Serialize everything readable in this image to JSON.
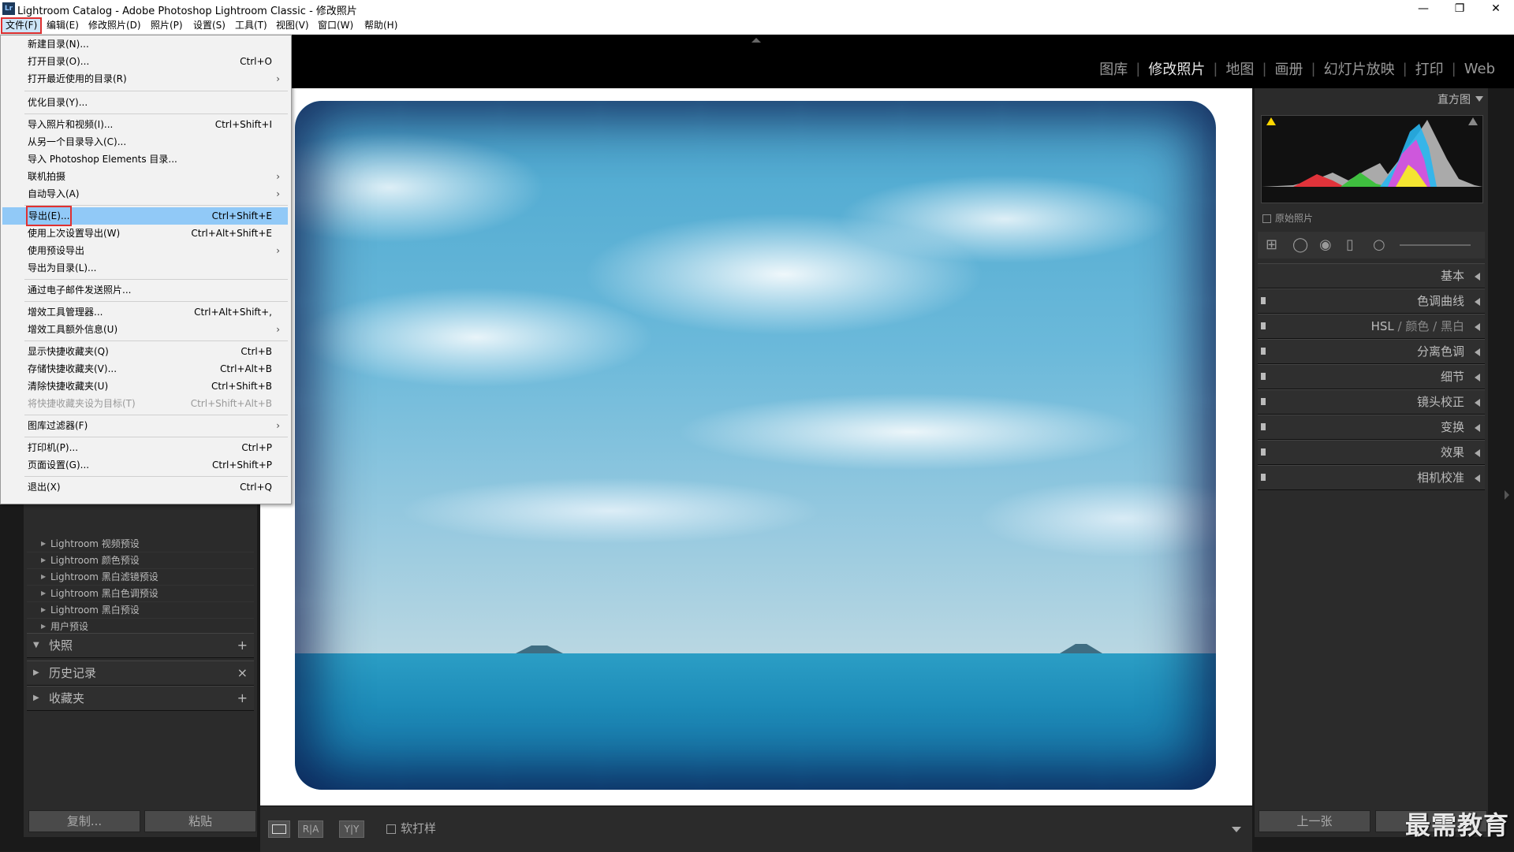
{
  "window": {
    "title": "Lightroom Catalog - Adobe Photoshop Lightroom Classic - 修改照片",
    "icon_text": "Lr",
    "controls": [
      "—",
      "❐",
      "✕"
    ]
  },
  "menubar": [
    "文件(F)",
    "编辑(E)",
    "修改照片(D)",
    "照片(P)",
    "设置(S)",
    "工具(T)",
    "视图(V)",
    "窗口(W)",
    "帮助(H)"
  ],
  "file_menu": {
    "items": [
      {
        "label": "新建目录(N)...",
        "shortcut": ""
      },
      {
        "label": "打开目录(O)...",
        "shortcut": "Ctrl+O"
      },
      {
        "label": "打开最近使用的目录(R)",
        "shortcut": "",
        "submenu": true
      },
      {
        "label": "优化目录(Y)...",
        "shortcut": ""
      },
      {
        "label": "导入照片和视频(I)...",
        "shortcut": "Ctrl+Shift+I"
      },
      {
        "label": "从另一个目录导入(C)...",
        "shortcut": ""
      },
      {
        "label": "导入 Photoshop Elements 目录...",
        "shortcut": ""
      },
      {
        "label": "联机拍摄",
        "shortcut": "",
        "submenu": true
      },
      {
        "label": "自动导入(A)",
        "shortcut": "",
        "submenu": true
      },
      {
        "label": "导出(E)...",
        "shortcut": "Ctrl+Shift+E",
        "highlighted": true
      },
      {
        "label": "使用上次设置导出(W)",
        "shortcut": "Ctrl+Alt+Shift+E"
      },
      {
        "label": "使用预设导出",
        "shortcut": "",
        "submenu": true
      },
      {
        "label": "导出为目录(L)...",
        "shortcut": ""
      },
      {
        "label": "通过电子邮件发送照片...",
        "shortcut": ""
      },
      {
        "label": "增效工具管理器...",
        "shortcut": "Ctrl+Alt+Shift+,"
      },
      {
        "label": "增效工具额外信息(U)",
        "shortcut": "",
        "submenu": true
      },
      {
        "label": "显示快捷收藏夹(Q)",
        "shortcut": "Ctrl+B"
      },
      {
        "label": "存储快捷收藏夹(V)...",
        "shortcut": "Ctrl+Alt+B"
      },
      {
        "label": "清除快捷收藏夹(U)",
        "shortcut": "Ctrl+Shift+B"
      },
      {
        "label": "将快捷收藏夹设为目标(T)",
        "shortcut": "Ctrl+Shift+Alt+B",
        "disabled": true
      },
      {
        "label": "图库过滤器(F)",
        "shortcut": "",
        "submenu": true
      },
      {
        "label": "打印机(P)...",
        "shortcut": "Ctrl+P"
      },
      {
        "label": "页面设置(G)...",
        "shortcut": "Ctrl+Shift+P"
      },
      {
        "label": "退出(X)",
        "shortcut": "Ctrl+Q"
      }
    ]
  },
  "modules": [
    "图库",
    "修改照片",
    "地图",
    "画册",
    "幻灯片放映",
    "打印",
    "Web"
  ],
  "left_panel": {
    "presets": [
      "Lightroom 视频预设",
      "Lightroom 颜色预设",
      "Lightroom 黑白滤镜预设",
      "Lightroom 黑白色调预设",
      "Lightroom 黑白预设",
      "用户预设"
    ],
    "snapshots": {
      "label": "快照",
      "action": "+"
    },
    "history": {
      "label": "历史记录",
      "action": "×"
    },
    "collections": {
      "label": "收藏夹",
      "action": "+"
    },
    "copy_button": "复制...",
    "paste_button": "粘贴"
  },
  "toolbar": {
    "view_loupe": "",
    "view_ra": "R|A",
    "view_yy": "Y|Y",
    "softproof_label": "软打样"
  },
  "right_panel": {
    "histogram_title": "直方图",
    "original_photo_label": "原始照片",
    "sections": [
      "基本",
      "色调曲线",
      "HSL",
      "颜色",
      "黑白",
      "分离色调",
      "细节",
      "镜头校正",
      "变换",
      "效果",
      "相机校准"
    ],
    "prev_button": "上一张"
  },
  "watermark": "最需教育",
  "colors": {
    "accent_highlight": "#91c9f7",
    "red_outline": "#e03030",
    "panel_bg": "#2b2b2b"
  }
}
